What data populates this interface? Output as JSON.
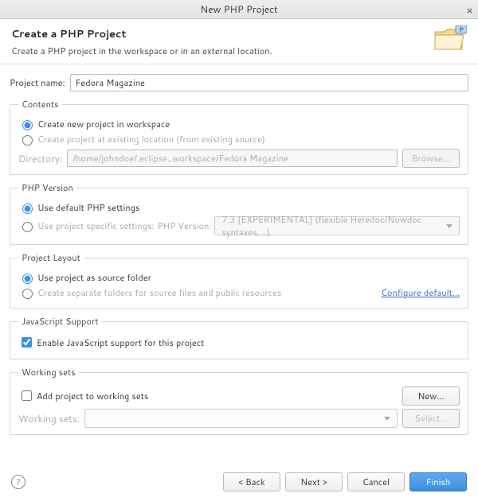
{
  "window": {
    "title": "New PHP Project"
  },
  "banner": {
    "heading": "Create a PHP Project",
    "subtitle": "Create a PHP project in the workspace or in an external location."
  },
  "projectName": {
    "label": "Project name:",
    "value": "Fedora Magazine"
  },
  "contents": {
    "legend": "Contents",
    "optNew": "Create new project in workspace",
    "optExisting": "Create project at existing location (from existing source)",
    "dirLabel": "Directory:",
    "dirValue": "/home/johndoe/.eclipse_workspace/Fedora Magazine",
    "browse": "Browse..."
  },
  "phpVersion": {
    "legend": "PHP Version",
    "optDefault": "Use default PHP settings",
    "optSpecific": "Use project specific settings:",
    "verLabel": "PHP Version:",
    "verValue": "7.3 [EXPERIMENTAL] (flexible Heredoc/Nowdoc syntaxes,...)"
  },
  "layout": {
    "legend": "Project Layout",
    "optSource": "Use project as source folder",
    "optSeparate": "Create separate folders for source files and public resources",
    "configure": "Configure default..."
  },
  "js": {
    "legend": "JavaScript Support",
    "enable": "Enable JavaScript support for this project"
  },
  "workingSets": {
    "legend": "Working sets",
    "add": "Add project to working sets",
    "newBtn": "New...",
    "label": "Working sets:",
    "selectBtn": "Select..."
  },
  "footer": {
    "back": "< Back",
    "next": "Next >",
    "cancel": "Cancel",
    "finish": "Finish"
  }
}
